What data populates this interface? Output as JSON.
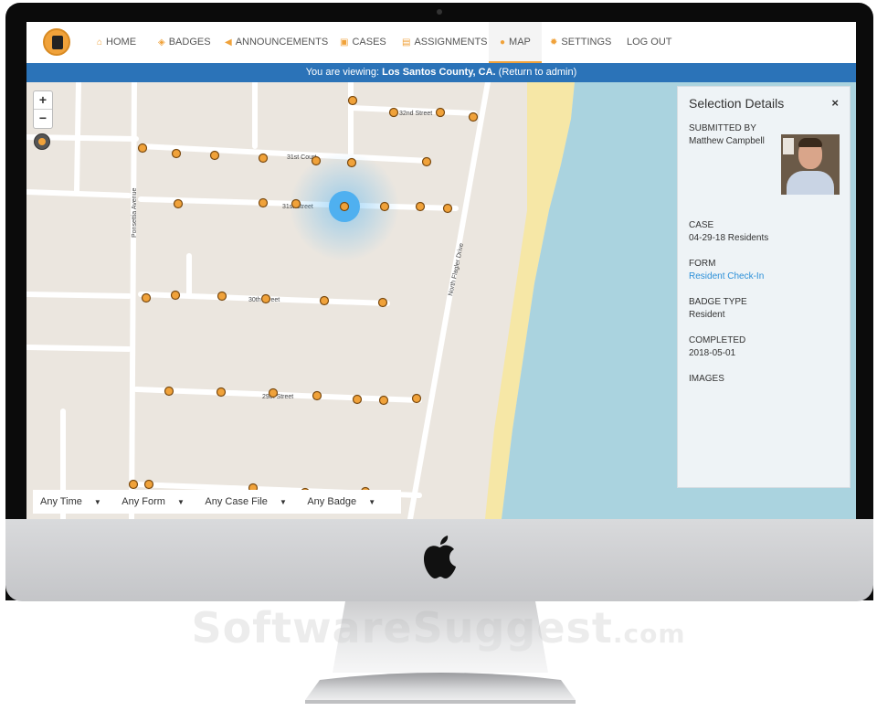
{
  "nav": {
    "items": [
      {
        "icon": "home-icon",
        "glyph": "⌂",
        "label": "HOME"
      },
      {
        "icon": "shield-icon",
        "glyph": "◈",
        "label": "BADGES"
      },
      {
        "icon": "megaphone-icon",
        "glyph": "◀",
        "label": "ANNOUNCEMENTS"
      },
      {
        "icon": "folder-icon",
        "glyph": "▣",
        "label": "CASES"
      },
      {
        "icon": "file-icon",
        "glyph": "▤",
        "label": "ASSIGNMENTS"
      },
      {
        "icon": "map-pin-icon",
        "glyph": "●",
        "label": "MAP"
      },
      {
        "icon": "gear-icon",
        "glyph": "✹",
        "label": "SETTINGS"
      },
      {
        "icon": "",
        "glyph": "",
        "label": "LOG OUT"
      }
    ],
    "active": "MAP"
  },
  "banner": {
    "prefix": "You are viewing: ",
    "county": "Los Santos County, CA.",
    "open_paren": " (",
    "link": "Return to admin",
    "close_paren": ")"
  },
  "map": {
    "zoom_in": "+",
    "zoom_out": "−",
    "street_labels": [
      "32nd Street",
      "31st Court",
      "31st Street",
      "30th Street",
      "29th Street",
      "Ponsettia Avenue",
      "North Flagler Drive"
    ]
  },
  "filters": [
    "Any Time",
    "Any Form",
    "Any Case File",
    "Any Badge"
  ],
  "panel": {
    "title": "Selection Details",
    "close": "×",
    "submitted_by_label": "SUBMITTED BY",
    "submitted_by": "Matthew Campbell",
    "case_label": "CASE",
    "case": "04-29-18 Residents",
    "form_label": "FORM",
    "form": "Resident Check-In",
    "badge_label": "BADGE TYPE",
    "badge": "Resident",
    "completed_label": "COMPLETED",
    "completed": "2018-05-01",
    "images_label": "IMAGES"
  },
  "watermark": {
    "main": "SoftwareSuggest",
    "suffix": ".com"
  },
  "colors": {
    "accent": "#f0a23a",
    "banner": "#2b73b8",
    "water": "#aad3df",
    "sand": "#f6e7a6",
    "link": "#2b8fd8"
  }
}
